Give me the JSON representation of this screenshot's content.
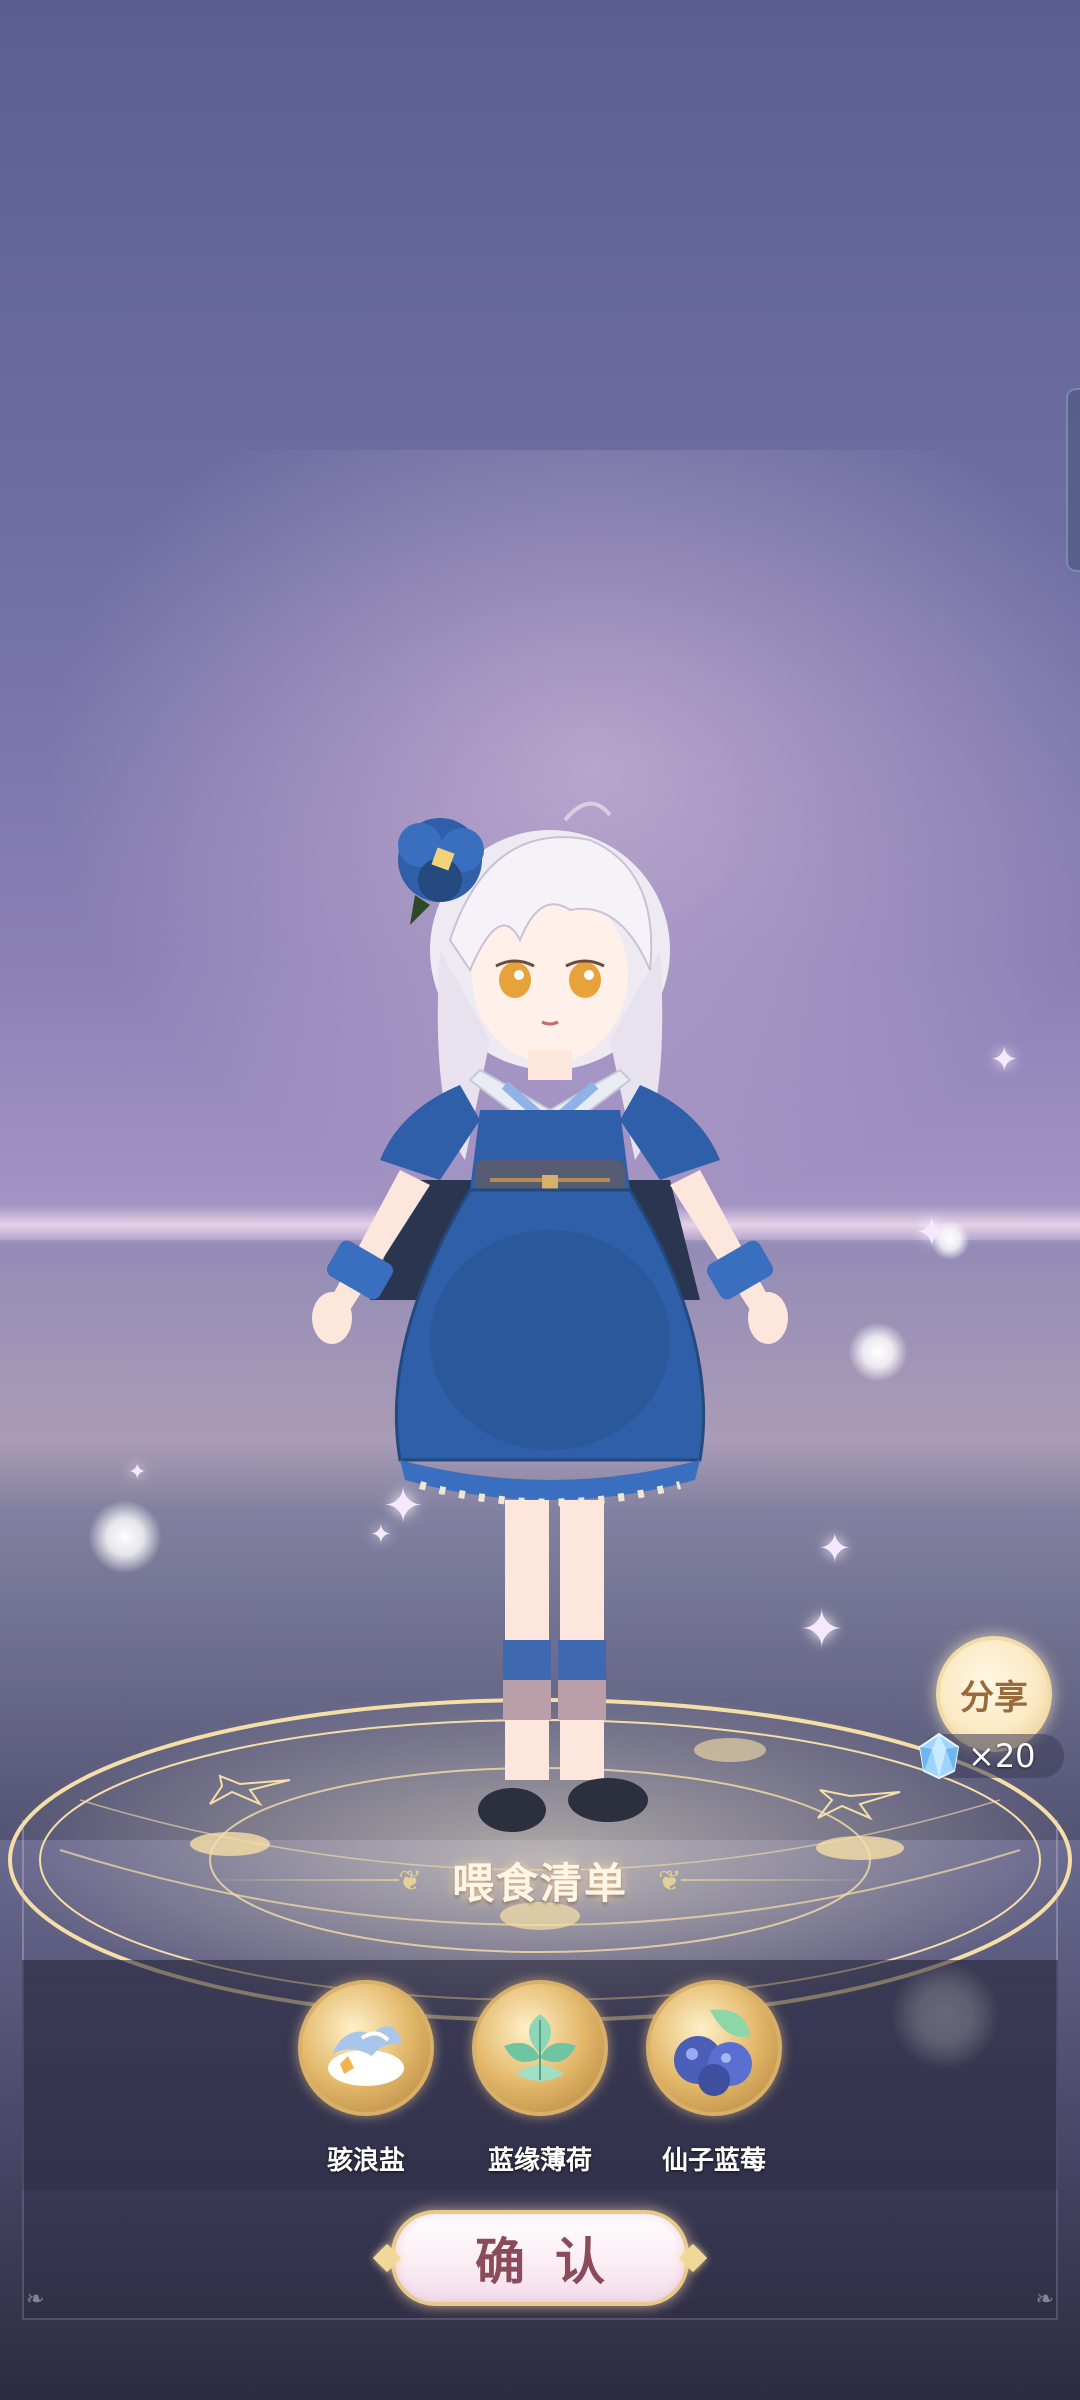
{
  "share": {
    "label": "分享",
    "reward_icon": "blue-crystal-icon",
    "reward_count": "×20"
  },
  "feed_panel": {
    "title": "喂食清单",
    "items": [
      {
        "label": "骇浪盐",
        "icon": "sea-salt-icon"
      },
      {
        "label": "蓝缘薄荷",
        "icon": "mint-icon"
      },
      {
        "label": "仙子蓝莓",
        "icon": "blueberry-icon"
      }
    ],
    "confirm_label": "确认"
  },
  "colors": {
    "sky_top": "#5b5e91",
    "accent_gold": "#e4cf96",
    "dress_blue": "#2f5fa8",
    "confirm_text": "#8a4b5a"
  }
}
